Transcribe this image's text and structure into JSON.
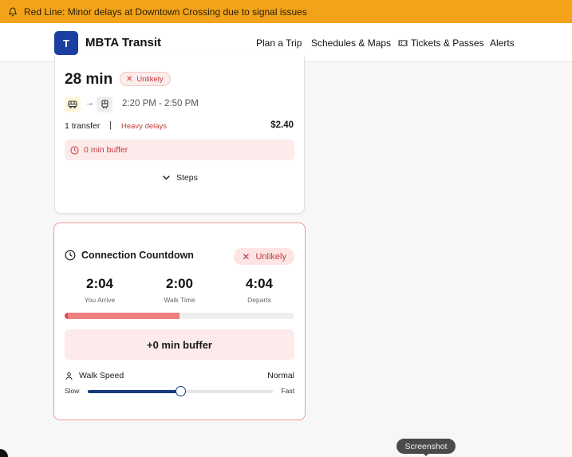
{
  "alert": {
    "text": "Red Line: Minor delays at Downtown Crossing due to signal issues",
    "icon": "bell-icon"
  },
  "nav": {
    "logo_letter": "T",
    "brand": "MBTA Transit",
    "links": {
      "plan": "Plan a Trip",
      "schedules": "Schedules & Maps",
      "tickets": "Tickets & Passes",
      "alerts": "Alerts"
    }
  },
  "trip": {
    "duration": "28 min",
    "status": "Unlikely",
    "time_range": "2:20 PM - 2:50 PM",
    "transfers": "1 transfer",
    "separator": "|",
    "delay_note": "Heavy delays",
    "price": "$2.40",
    "buffer": "0 min buffer",
    "steps_label": "Steps"
  },
  "countdown": {
    "title": "Connection Countdown",
    "status": "Unlikely",
    "arrive_value": "2:04",
    "arrive_label": "You Arrive",
    "walk_value": "2:00",
    "walk_label": "Walk Time",
    "depart_value": "4:04",
    "depart_label": "Departs",
    "progress_fraction": 0.5,
    "buffer_text": "+0 min buffer",
    "walk_speed_label": "Walk Speed",
    "walk_speed_value": "Normal",
    "slider_min_label": "Slow",
    "slider_max_label": "Fast",
    "slider_fraction": 0.5
  },
  "overlay": {
    "screenshot_label": "Screenshot"
  },
  "colors": {
    "alert_bg": "#f2a31a",
    "brand_blue": "#1a3fa1",
    "danger": "#c23b3b",
    "slider": "#1a3a80"
  }
}
